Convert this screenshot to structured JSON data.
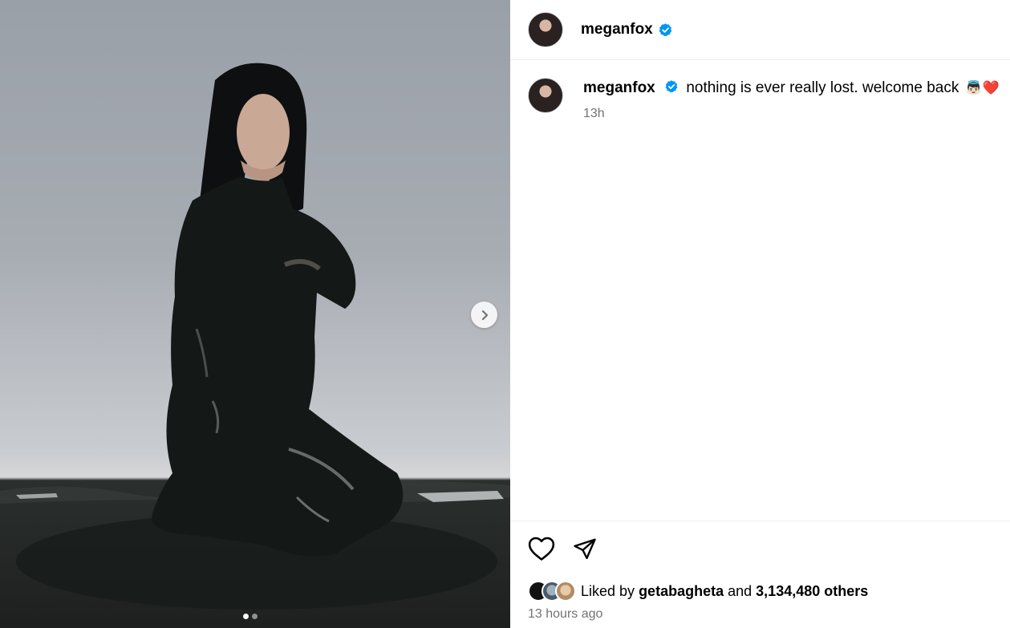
{
  "post": {
    "media": {
      "next_icon": "chevron-right-icon",
      "slide_count": 2,
      "current_slide": 1
    },
    "header": {
      "username": "meganfox",
      "verified_icon": "verified-badge-icon"
    },
    "caption": {
      "username": "meganfox",
      "text": "nothing is ever really lost. welcome back",
      "emojis": "👼🏻❤️",
      "time_short": "13h"
    },
    "actions": {
      "like_icon": "heart-icon",
      "share_icon": "paper-plane-icon"
    },
    "likes": {
      "prefix": "Liked by",
      "user": "getabagheta",
      "middle": "and",
      "count": "3,134,480 others"
    },
    "time_long": "13 hours ago"
  },
  "colors": {
    "verified": "#0095f6",
    "secondary_text": "#737373",
    "divider": "#efefef"
  }
}
